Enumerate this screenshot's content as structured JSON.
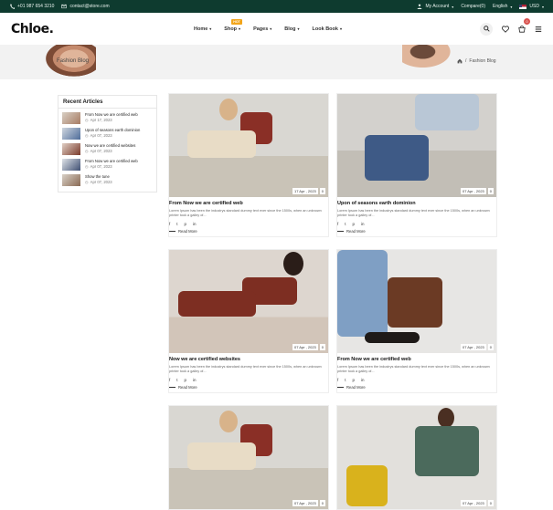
{
  "topbar": {
    "phone": "+01 987 654 3210",
    "email": "contact@store.com",
    "account": "My Account",
    "compare": "Compare(0)",
    "language": "English",
    "currency": "USD"
  },
  "header": {
    "logo": "Chloe.",
    "nav": [
      {
        "label": "Home"
      },
      {
        "label": "Shop",
        "badge": "HOT"
      },
      {
        "label": "Pages"
      },
      {
        "label": "Blog"
      },
      {
        "label": "Look Book"
      }
    ],
    "cart_count": "0",
    "icons": [
      "search-icon",
      "heart-icon",
      "cart-icon",
      "menu-icon"
    ]
  },
  "banner": {
    "title": "Fashion Blog",
    "breadcrumb_sep": "/",
    "breadcrumb_current": "Fashion Blog"
  },
  "sidebar": {
    "title": "Recent Articles",
    "items": [
      {
        "title": "From Now we are certified web",
        "date": "Apr 17, 2023"
      },
      {
        "title": "Upon of seasons earth dominion",
        "date": "Apr 07, 2023"
      },
      {
        "title": "Now we are certified websites",
        "date": "Apr 07, 2023"
      },
      {
        "title": "From Now we are certified web",
        "date": "Apr 07, 2023"
      },
      {
        "title": "Show the tune",
        "date": "Apr 07, 2023"
      }
    ]
  },
  "posts": [
    {
      "title": "From Now we are certified web",
      "date": "17 Apr , 2023",
      "comments": "0",
      "excerpt": "Lorem Ipsum has been the industrys standard dummy text ever since the 1500s, when an unknown printer took a galley of...",
      "read_more": "Read More"
    },
    {
      "title": "Upon of seasons earth dominion",
      "date": "07 Apr , 2023",
      "comments": "0",
      "excerpt": "Lorem Ipsum has been the industrys standard dummy text ever since the 1500s, when an unknown printer took a galley of...",
      "read_more": "Read More"
    },
    {
      "title": "Now we are certified websites",
      "date": "07 Apr , 2023",
      "comments": "0",
      "excerpt": "Lorem Ipsum has been the industrys standard dummy text ever since the 1500s, when an unknown printer took a galley of...",
      "read_more": "Read More"
    },
    {
      "title": "From Now we are certified web",
      "date": "07 Apr , 2023",
      "comments": "0",
      "excerpt": "Lorem Ipsum has been the industrys standard dummy text ever since the 1500s, when an unknown printer took a galley of...",
      "read_more": "Read More"
    },
    {
      "title": "",
      "date": "07 Apr , 2023",
      "comments": "0"
    },
    {
      "title": "",
      "date": "07 Apr , 2023",
      "comments": "0"
    }
  ],
  "social": {
    "f": "f",
    "t": "t",
    "p": "p",
    "in": "in"
  }
}
